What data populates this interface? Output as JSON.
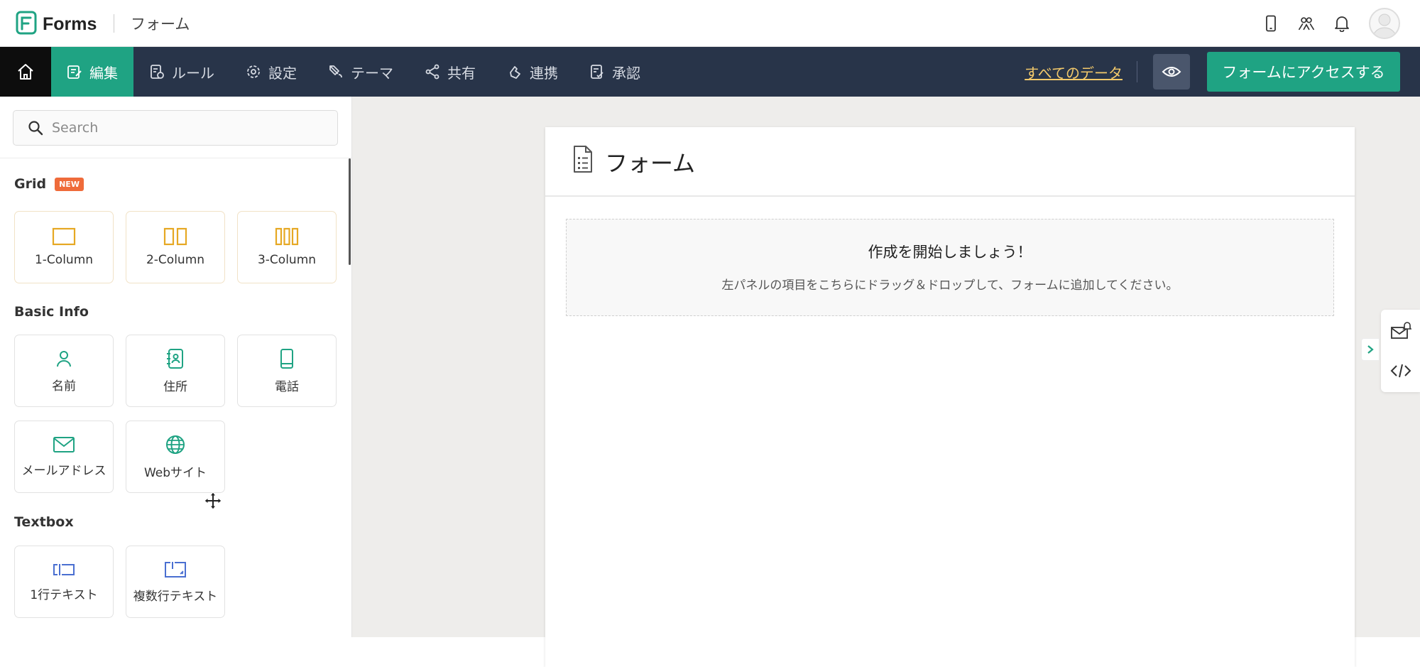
{
  "topbar": {
    "app_name": "Forms",
    "form_name": "フォーム"
  },
  "nav": {
    "items": [
      {
        "label": "編集",
        "icon": "edit-icon",
        "active": true
      },
      {
        "label": "ルール",
        "icon": "rules-icon"
      },
      {
        "label": "設定",
        "icon": "gear-icon"
      },
      {
        "label": "テーマ",
        "icon": "theme-brush-icon"
      },
      {
        "label": "共有",
        "icon": "share-icon"
      },
      {
        "label": "連携",
        "icon": "integration-icon"
      },
      {
        "label": "承認",
        "icon": "approval-icon"
      }
    ],
    "all_data": "すべてのデータ",
    "access_button": "フォームにアクセスする"
  },
  "sidebar": {
    "search_placeholder": "Search",
    "sections": [
      {
        "title": "Grid",
        "badge": "NEW",
        "items": [
          "1-Column",
          "2-Column",
          "3-Column"
        ]
      },
      {
        "title": "Basic Info",
        "items": [
          "名前",
          "住所",
          "電話",
          "メールアドレス",
          "Webサイト"
        ]
      },
      {
        "title": "Textbox",
        "items": [
          "1行テキスト",
          "複数行テキスト"
        ]
      }
    ]
  },
  "form": {
    "title": "フォーム",
    "empty_title": "作成を開始しましょう！",
    "empty_subtitle": "左パネルの項目をこちらにドラッグ＆ドロップして、フォームに追加してください。"
  },
  "colors": {
    "nav_bg": "#283449",
    "accent_green": "#1fa383",
    "grid_icon": "#e6a823",
    "basic_icon": "#1fa383",
    "textbox_icon": "#4a6fd1",
    "new_badge": "#ef6b3a",
    "all_data_link": "#f3c96b"
  }
}
